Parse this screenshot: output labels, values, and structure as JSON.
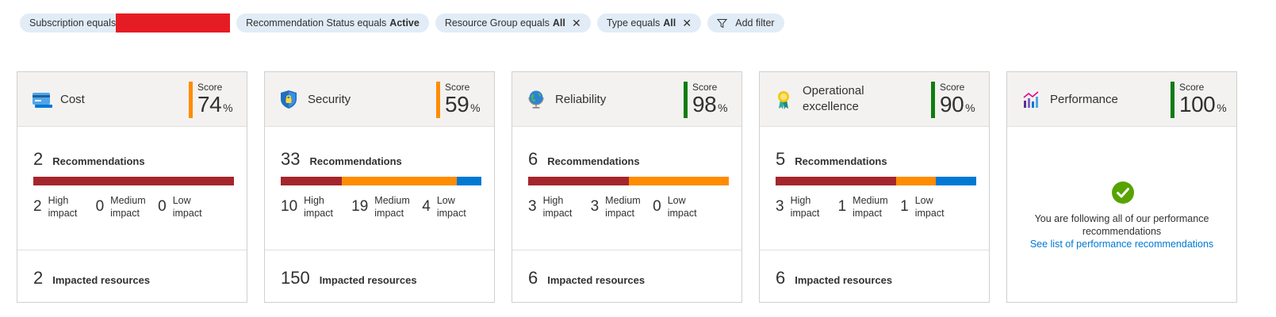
{
  "filters": {
    "subscription": {
      "label": "Subscription equals",
      "value": ""
    },
    "status": {
      "label": "Recommendation Status equals",
      "value": "Active"
    },
    "resource_group": {
      "label": "Resource Group equals",
      "value": "All",
      "close": "✕"
    },
    "type": {
      "label": "Type equals",
      "value": "All",
      "close": "✕"
    },
    "add_filter": "Add filter"
  },
  "cards": {
    "cost": {
      "title": "Cost",
      "score_label": "Score",
      "score": "74",
      "pct": "%",
      "score_color": "#ff8c00",
      "rec_count": "2",
      "rec_label": "Recommendations",
      "high": "2",
      "high_label": "High impact",
      "medium": "0",
      "medium_label": "Medium impact",
      "low": "0",
      "low_label": "Low impact",
      "res_count": "2",
      "res_label": "Impacted resources"
    },
    "security": {
      "title": "Security",
      "score_label": "Score",
      "score": "59",
      "pct": "%",
      "score_color": "#ff8c00",
      "rec_count": "33",
      "rec_label": "Recommendations",
      "high": "10",
      "high_label": "High impact",
      "medium": "19",
      "medium_label": "Medium impact",
      "low": "4",
      "low_label": "Low impact",
      "res_count": "150",
      "res_label": "Impacted resources"
    },
    "reliability": {
      "title": "Reliability",
      "score_label": "Score",
      "score": "98",
      "pct": "%",
      "score_color": "#107c10",
      "rec_count": "6",
      "rec_label": "Recommendations",
      "high": "3",
      "high_label": "High impact",
      "medium": "3",
      "medium_label": "Medium impact",
      "low": "0",
      "low_label": "Low impact",
      "res_count": "6",
      "res_label": "Impacted resources"
    },
    "operational": {
      "title": "Operational excellence",
      "score_label": "Score",
      "score": "90",
      "pct": "%",
      "score_color": "#107c10",
      "rec_count": "5",
      "rec_label": "Recommendations",
      "high": "3",
      "high_label": "High impact",
      "medium": "1",
      "medium_label": "Medium impact",
      "low": "1",
      "low_label": "Low impact",
      "res_count": "6",
      "res_label": "Impacted resources"
    },
    "performance": {
      "title": "Performance",
      "score_label": "Score",
      "score": "100",
      "pct": "%",
      "score_color": "#107c10",
      "message": "You are following all of our performance recommendations",
      "link": "See list of performance recommendations"
    }
  },
  "colors": {
    "high": "#a4262c",
    "medium": "#ff8c00",
    "low": "#0078d4",
    "redaction": "#e51c23",
    "check": "#107c10"
  }
}
